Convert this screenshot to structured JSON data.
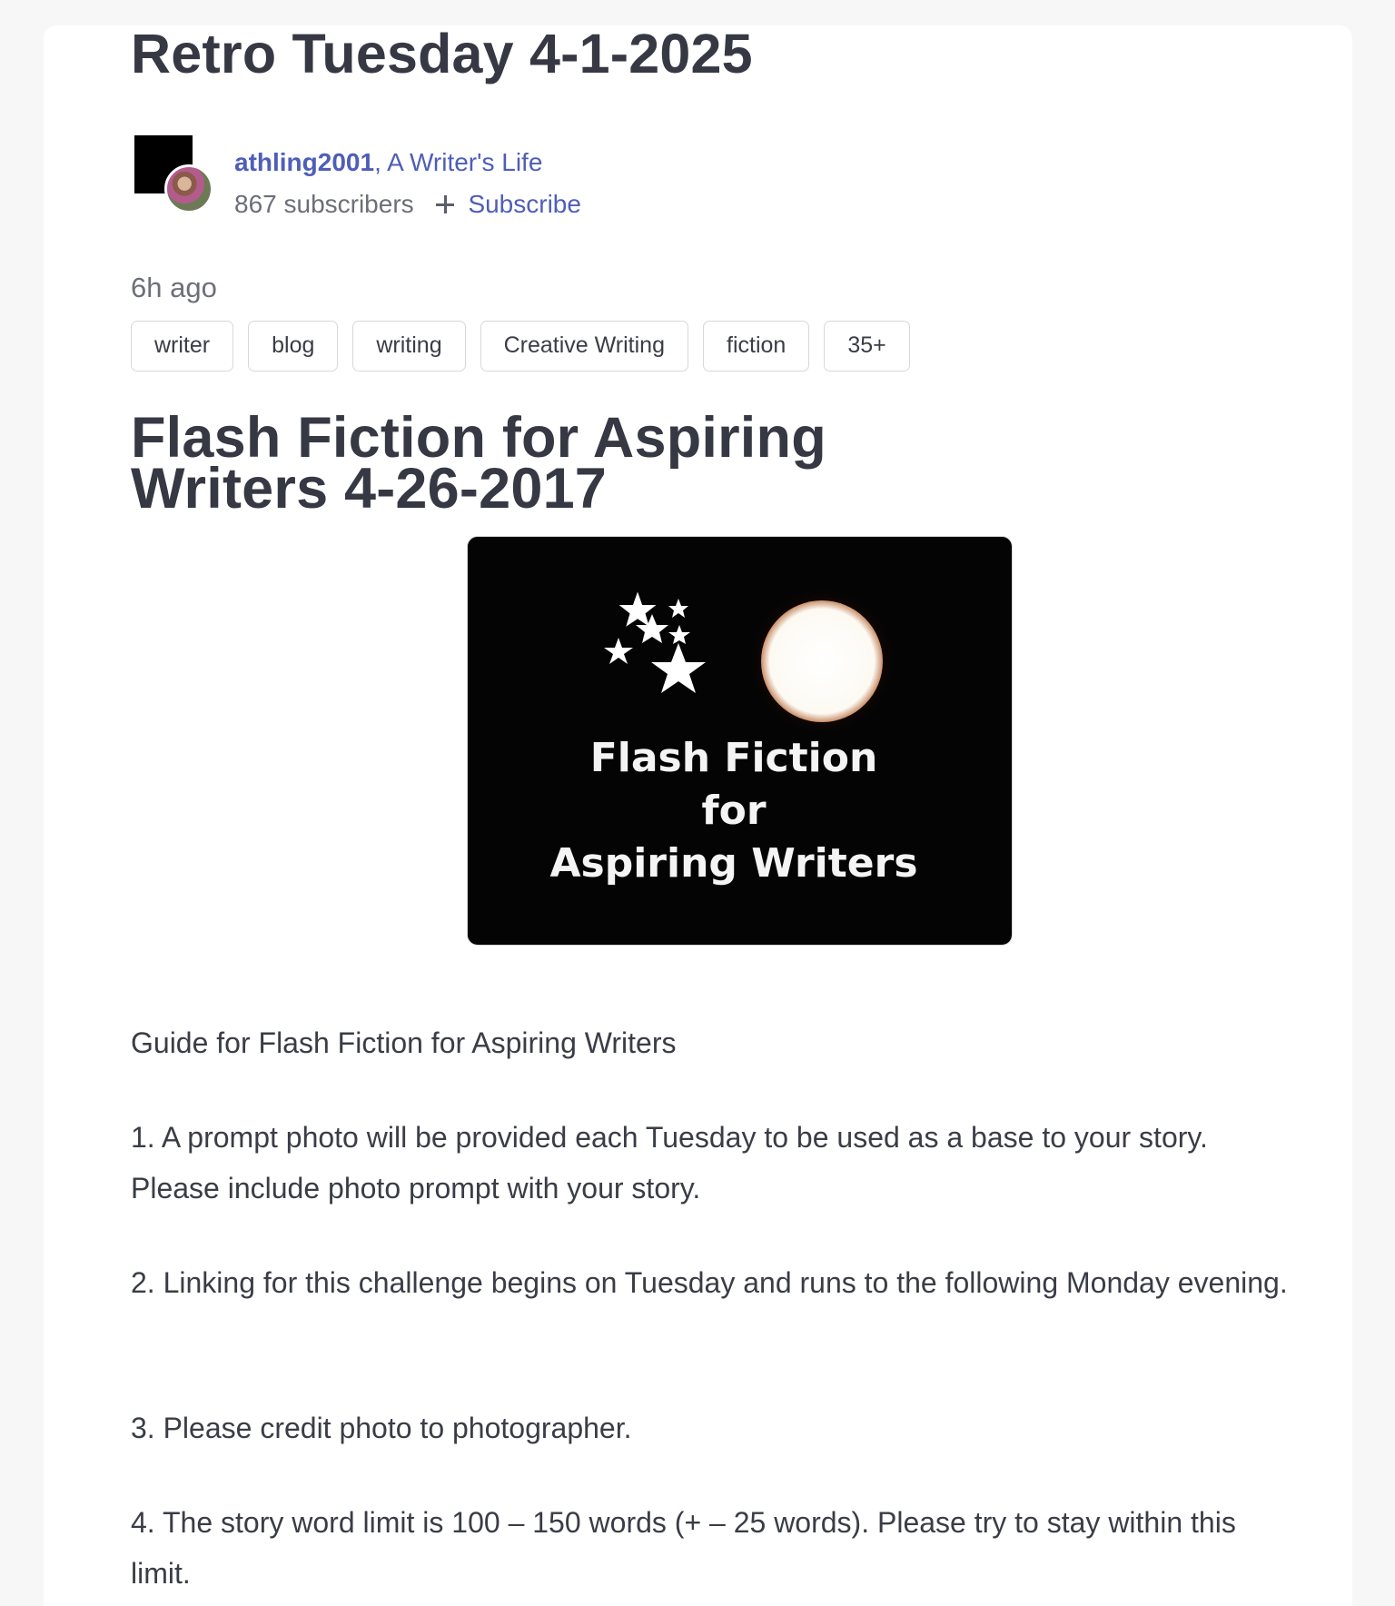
{
  "post": {
    "title": "Retro Tuesday 4-1-2025",
    "author": {
      "name": "athling2001",
      "separator": ",",
      "blog": "A Writer's Life",
      "subscribers": "867 subscribers",
      "subscribe_label": "Subscribe"
    },
    "timestamp": "6h ago",
    "tags": [
      "writer",
      "blog",
      "writing",
      "Creative Writing",
      "fiction",
      "35+"
    ],
    "article_heading": "Flash Fiction for Aspiring Writers 4-26-2017",
    "image": {
      "text_line1": "Flash Fiction",
      "text_line2": "for",
      "text_line3": "Aspiring Writers"
    },
    "paragraphs": [
      "Guide for Flash Fiction for Aspiring Writers",
      "1. A prompt photo will be provided each Tuesday to be used as a base to your story. Please include photo prompt with your story.",
      "2. Linking for this challenge begins on Tuesday and runs to the following Monday evening.",
      "3. Please credit photo to photographer.",
      "4. The story word limit is 100 – 150 words (+ – 25 words). Please try to stay within this limit."
    ]
  },
  "colors": {
    "link": "#4e5eb8",
    "heading": "#363943",
    "muted": "#6c6f78",
    "page_bg": "#f7f7f8"
  }
}
